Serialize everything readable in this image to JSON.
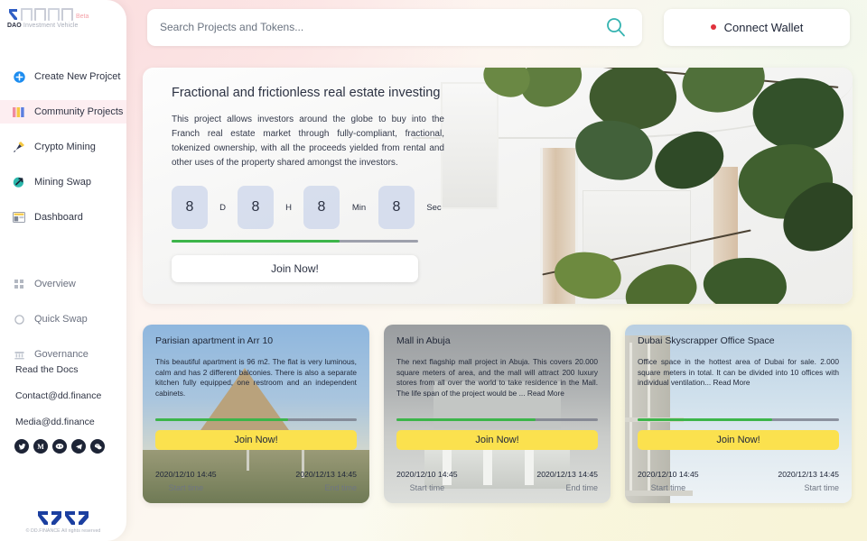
{
  "brand": {
    "name_marks": "DAOA",
    "beta": "Beta",
    "sub_bold": "DAO",
    "sub_rest": " Investment Vehicle"
  },
  "sidebar": {
    "primary_items": [
      {
        "label": "Create New Projcet",
        "icon": "plus-circle-icon",
        "active": false
      },
      {
        "label": "Community Projects",
        "icon": "bars-color-icon",
        "active": true
      },
      {
        "label": "Crypto Mining",
        "icon": "hammer-icon",
        "active": false
      },
      {
        "label": "Mining Swap",
        "icon": "swap-arrow-icon",
        "active": false
      },
      {
        "label": "Dashboard",
        "icon": "dashboard-icon",
        "active": false
      }
    ],
    "secondary_items": [
      {
        "label": "Overview",
        "icon": "grid-icon"
      },
      {
        "label": "Quick Swap",
        "icon": "circle-icon"
      },
      {
        "label": "Governance",
        "icon": "bank-icon"
      }
    ],
    "links": [
      "Read the Docs",
      "Contact@dd.finance",
      "Media@dd.finance"
    ],
    "socials": [
      {
        "name": "twitter-icon",
        "glyph": "ᴠ"
      },
      {
        "name": "medium-icon",
        "glyph": "M"
      },
      {
        "name": "discord-icon",
        "glyph": "●●"
      },
      {
        "name": "telegram-icon",
        "glyph": "➤"
      },
      {
        "name": "wechat-icon",
        "glyph": "✆"
      }
    ],
    "copyright": "© DD.FINANCE All rights reserved"
  },
  "search": {
    "placeholder": "Search Projects and Tokens...",
    "value": "",
    "icon": "search-icon",
    "icon_color": "#34b3b0"
  },
  "wallet": {
    "label": "Connect Wallet",
    "status_color": "#e0313c"
  },
  "hero": {
    "title": "Fractional and frictionless real estate investing",
    "description": "This project allows investors around the globe to buy into the Franch real estate market through fully-compliant, fractional, tokenized ownership, with all the proceeds yielded from rental and other uses of the property shared amongst the investors.",
    "countdown": [
      {
        "value": "8",
        "unit": "D"
      },
      {
        "value": "8",
        "unit": "H"
      },
      {
        "value": "8",
        "unit": "Min"
      },
      {
        "value": "8",
        "unit": "Sec"
      }
    ],
    "progress_percent": 68,
    "join_label": "Join Now!"
  },
  "cards": [
    {
      "title": "Parisian apartment in Arr 10",
      "description": "This beautiful apartment is 96 m2. The flat is very luminous, calm and has 2 different balconies. There is also a separate kitchen fully equipped, one restroom and an independent cabinets.",
      "read_more": "",
      "progress_percent": 66,
      "join_label": "Join Now!",
      "start_value": "2020/12/10 14:45",
      "start_label": "Start time",
      "end_value": "2020/12/13 14:45",
      "end_label": "End time"
    },
    {
      "title": "Mall in Abuja",
      "description": "The next flagship mall project in Abuja. This covers 20.000 square meters of area, and the mall will attract 200 luxury stores from all over the world to take residence in the Mall. The life span of the project would be ...",
      "read_more": "Read More",
      "progress_percent": 69,
      "join_label": "Join Now!",
      "start_value": "2020/12/10 14:45",
      "start_label": "Start time",
      "end_value": "2020/12/13 14:45",
      "end_label": "End time"
    },
    {
      "title": "Dubai Skyscrapper Office Space",
      "description": "Office space in the hottest area of Dubai for sale. 2.000 square meters in total. It can be divided into 10 offices with individual ventilation...",
      "read_more": "Read More",
      "progress_percent": 67,
      "join_label": "Join Now!",
      "start_value": "2020/12/10 14:45",
      "start_label": "Start time",
      "end_value": "2020/12/13 14:45",
      "end_label": "Start time"
    }
  ],
  "colors": {
    "accent_yellow": "#fbe14e",
    "progress_green": "#3cb54a",
    "active_pink": "#fdeef1",
    "search_teal": "#34b3b0"
  }
}
